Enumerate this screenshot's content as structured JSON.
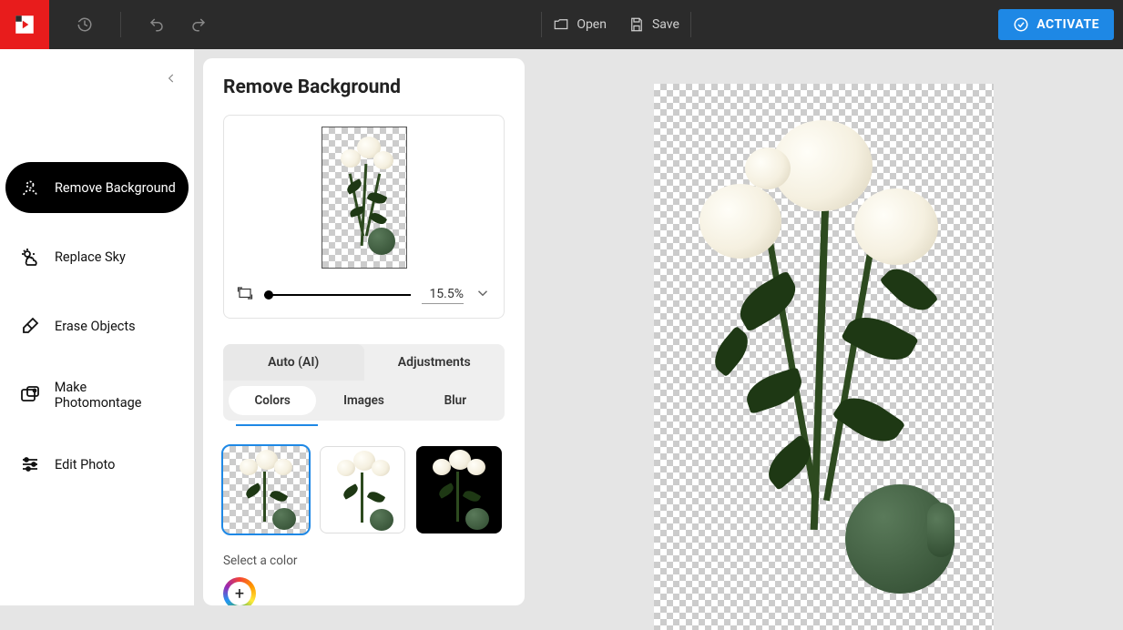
{
  "topbar": {
    "open_label": "Open",
    "save_label": "Save",
    "activate_label": "ACTIVATE"
  },
  "sidebar": {
    "items": [
      {
        "label": "Remove Background"
      },
      {
        "label": "Replace Sky"
      },
      {
        "label": "Erase Objects"
      },
      {
        "label": "Make Photomontage"
      },
      {
        "label": "Edit Photo"
      }
    ]
  },
  "panel": {
    "title": "Remove Background",
    "zoom_value": "15.5%",
    "tabs_top": [
      {
        "label": "Auto (AI)"
      },
      {
        "label": "Adjustments"
      }
    ],
    "tabs_sub": [
      {
        "label": "Colors"
      },
      {
        "label": "Images"
      },
      {
        "label": "Blur"
      }
    ],
    "select_color_label": "Select a color"
  }
}
